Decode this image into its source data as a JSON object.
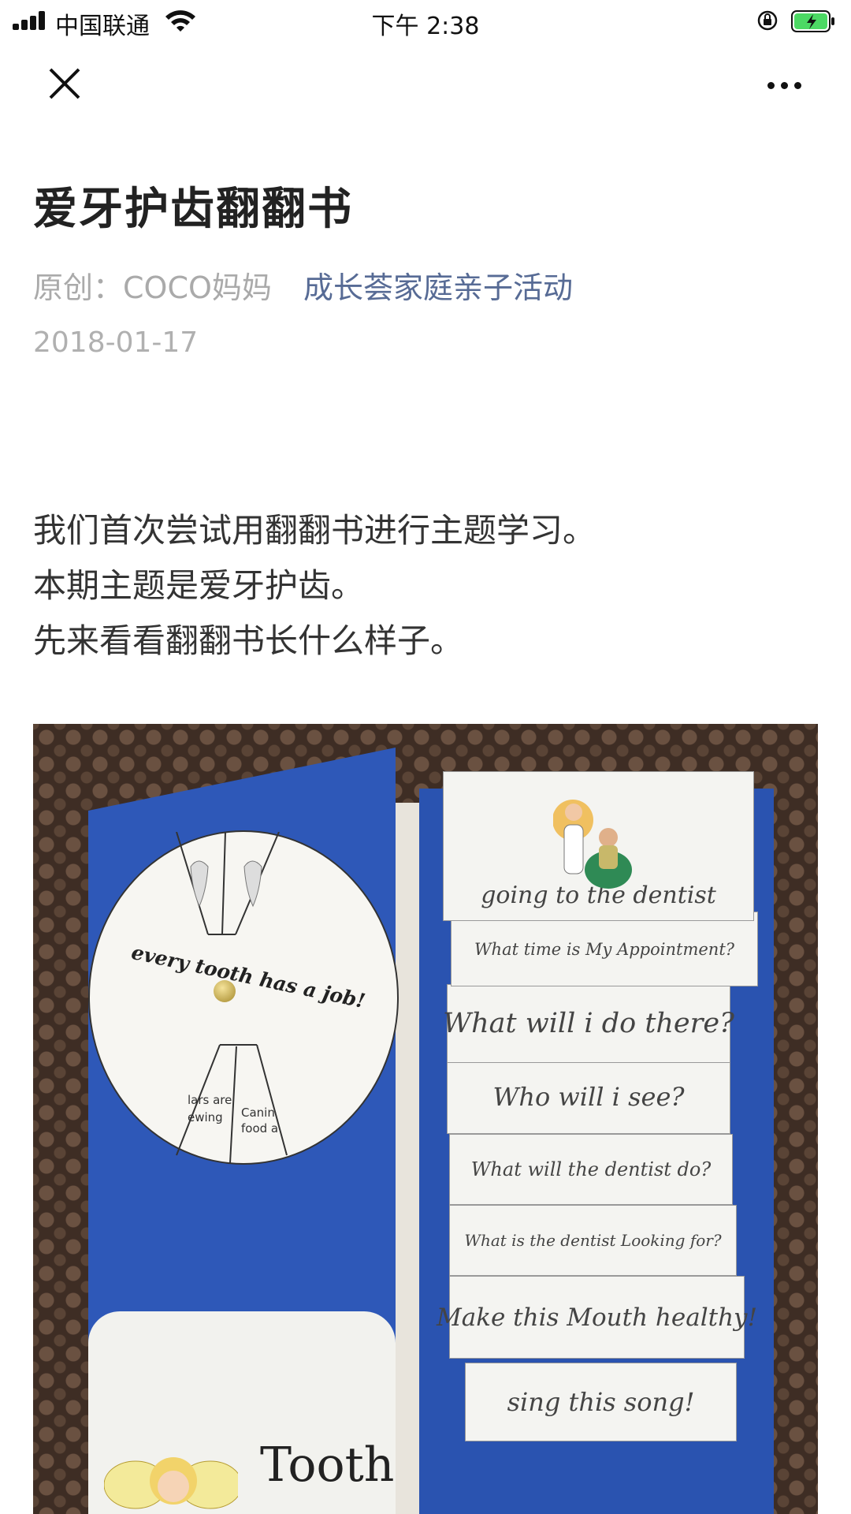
{
  "status_bar": {
    "carrier": "中国联通",
    "time": "下午 2:38"
  },
  "article": {
    "title": "爱牙护齿翻翻书",
    "author": "原创：COCO妈妈",
    "account": "成长荟家庭亲子活动",
    "date": "2018-01-17",
    "paragraphs": [
      "我们首次尝试用翻翻书进行主题学习。",
      "本期主题是爱牙护齿。",
      "先来看看翻翻书长什么样子。"
    ]
  },
  "photo": {
    "wheel_text": "every tooth has a job!",
    "wheel_snippets": [
      "lars are",
      "ewing",
      "Canin",
      "food a"
    ],
    "pocket_label": "Tooth",
    "flaps": [
      "going to the dentist",
      "What time is My Appointment?",
      "What will i do there?",
      "Who will i see?",
      "What will the dentist do?",
      "What is the dentist Looking for?",
      "Make this Mouth healthy!",
      "sing this song!"
    ]
  },
  "colors": {
    "accent_link": "#576b95",
    "meta_gray": "#aaaaaa",
    "book_blue": "#2e58b8"
  },
  "icons": [
    "signal-icon",
    "wifi-icon",
    "rotation-lock-icon",
    "battery-charging-icon",
    "close-icon",
    "more-icon"
  ]
}
